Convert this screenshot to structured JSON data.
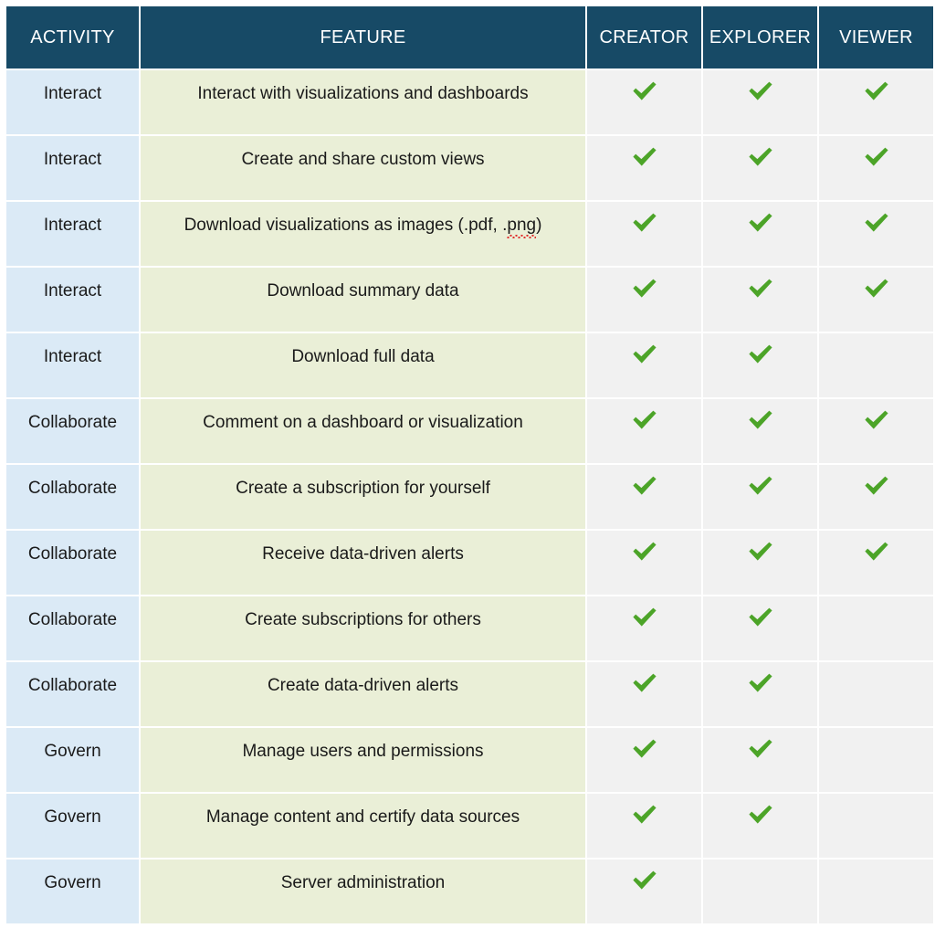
{
  "table": {
    "columns": [
      {
        "key": "activity",
        "label": "ACTIVITY"
      },
      {
        "key": "feature",
        "label": "FEATURE"
      },
      {
        "key": "creator",
        "label": "CREATOR"
      },
      {
        "key": "explorer",
        "label": "EXPLORER"
      },
      {
        "key": "viewer",
        "label": "VIEWER"
      }
    ],
    "rows": [
      {
        "activity": "Interact",
        "feature": "Interact with visualizations and dashboards",
        "creator": true,
        "explorer": true,
        "viewer": true
      },
      {
        "activity": "Interact",
        "feature": "Create and share custom views",
        "creator": true,
        "explorer": true,
        "viewer": true
      },
      {
        "activity": "Interact",
        "feature": "Download visualizations as images (.pdf, .png)",
        "feature_misspelled": "png",
        "creator": true,
        "explorer": true,
        "viewer": true
      },
      {
        "activity": "Interact",
        "feature": "Download summary data",
        "creator": true,
        "explorer": true,
        "viewer": true
      },
      {
        "activity": "Interact",
        "feature": "Download full data",
        "creator": true,
        "explorer": true,
        "viewer": false
      },
      {
        "activity": "Collaborate",
        "feature": "Comment on a dashboard or visualization",
        "creator": true,
        "explorer": true,
        "viewer": true
      },
      {
        "activity": "Collaborate",
        "feature": "Create a subscription for yourself",
        "creator": true,
        "explorer": true,
        "viewer": true
      },
      {
        "activity": "Collaborate",
        "feature": "Receive data-driven alerts",
        "creator": true,
        "explorer": true,
        "viewer": true
      },
      {
        "activity": "Collaborate",
        "feature": "Create subscriptions for others",
        "creator": true,
        "explorer": true,
        "viewer": false
      },
      {
        "activity": "Collaborate",
        "feature": "Create data-driven alerts",
        "creator": true,
        "explorer": true,
        "viewer": false
      },
      {
        "activity": "Govern",
        "feature": "Manage users and permissions",
        "creator": true,
        "explorer": true,
        "viewer": false
      },
      {
        "activity": "Govern",
        "feature": "Manage content and certify data sources",
        "creator": true,
        "explorer": true,
        "viewer": false
      },
      {
        "activity": "Govern",
        "feature": "Server administration",
        "creator": true,
        "explorer": false,
        "viewer": false
      }
    ]
  },
  "icons": {
    "check": "check-mark-icon"
  },
  "colors": {
    "header_background": "#174A66",
    "header_text": "#FFFFFF",
    "activity_cell": "#DBEAF6",
    "feature_cell": "#EAEFD7",
    "role_cell": "#F1F1F1",
    "check_green": "#4CA428",
    "body_text": "#1A1A1A",
    "spellcheck_underline": "#E03030"
  }
}
